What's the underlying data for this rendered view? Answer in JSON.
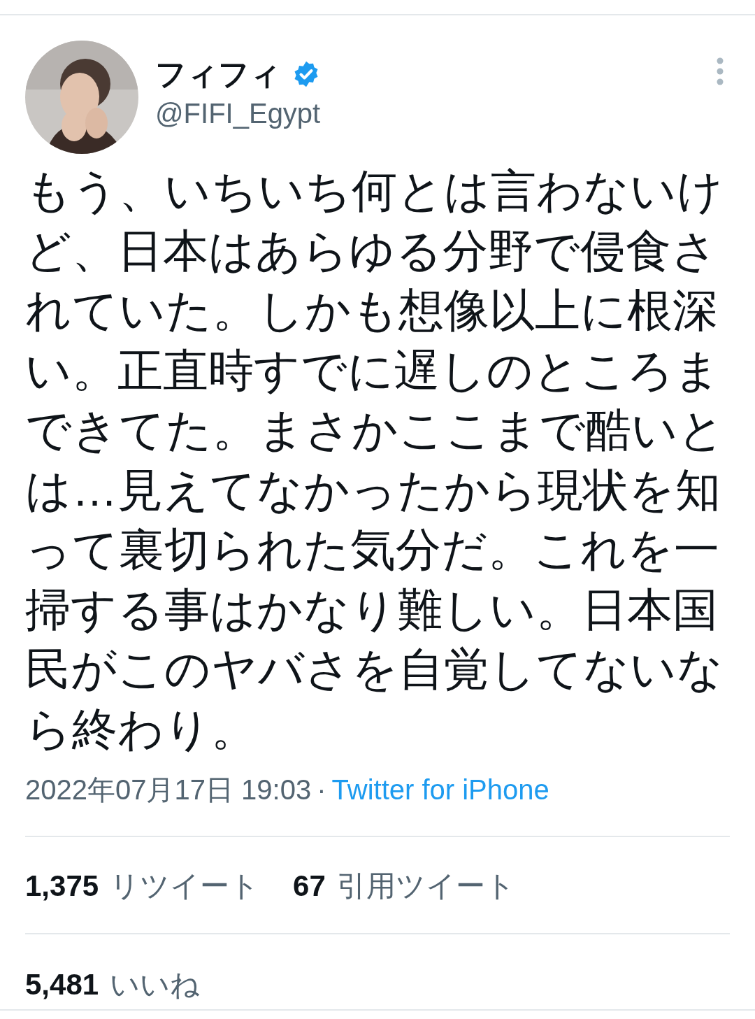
{
  "tweet": {
    "author": {
      "name": "フィフィ",
      "verified": true,
      "handle": "@FIFI_Egypt"
    },
    "text": "もう、いちいち何とは言わないけど、日本はあらゆる分野で侵食されていた。しかも想像以上に根深い。正直時すでに遅しのところまできてた。まさかここまで酷いとは…見えてなかったから現状を知って裏切られた気分だ。これを一掃する事はかなり難しい。日本国民がこのヤバさを自覚してないなら終わり。",
    "timestamp": "2022年07月17日 19:03",
    "separator": "·",
    "source": "Twitter for iPhone",
    "stats": [
      {
        "count": "1,375",
        "label": "リツイート"
      },
      {
        "count": "67",
        "label": "引用ツイート"
      }
    ],
    "likes": {
      "count": "5,481",
      "label": "いいね"
    }
  }
}
